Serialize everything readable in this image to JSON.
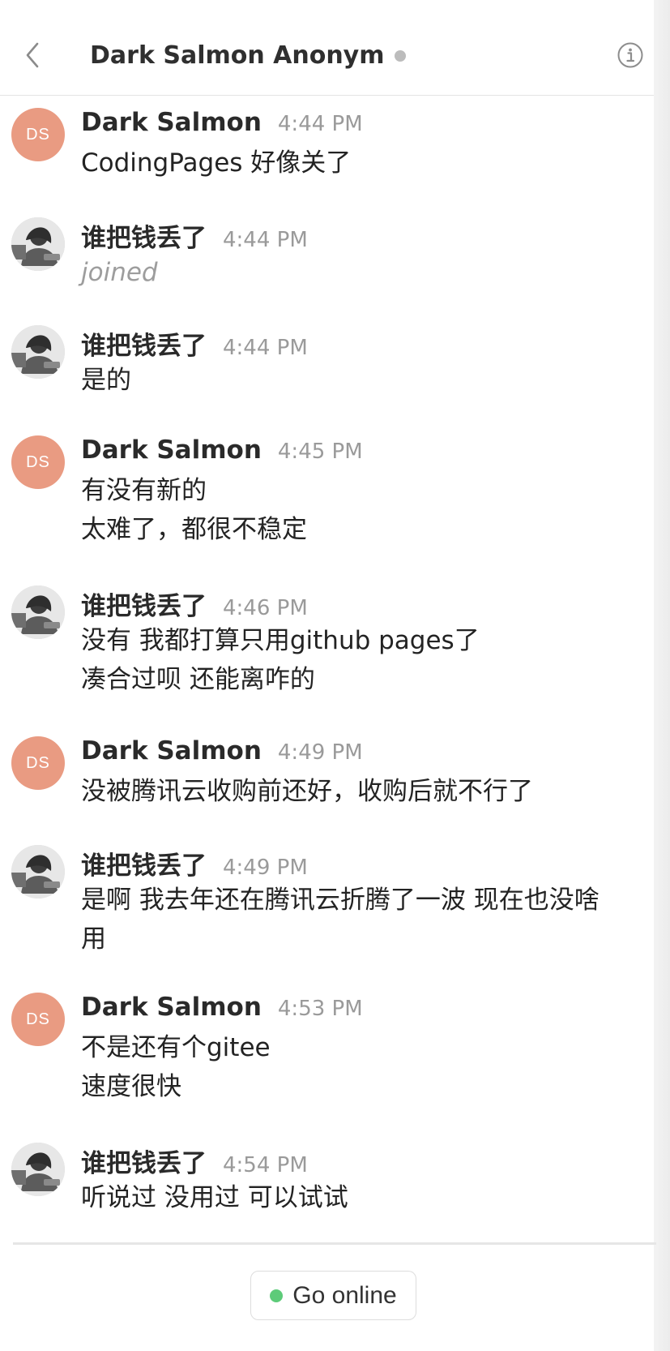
{
  "header": {
    "title": "Dark Salmon Anonym",
    "back_icon": "chevron-left-icon",
    "status_icon": "presence-dot-icon",
    "info_icon": "info-icon"
  },
  "avatars": {
    "ds": "DS"
  },
  "messages": [
    {
      "author": "Dark Salmon",
      "time": "4:44 PM",
      "lines": [
        "CodingPages 好像关了"
      ]
    },
    {
      "author": "谁把钱丢了",
      "time": "4:44 PM",
      "system": "joined"
    },
    {
      "author": "谁把钱丢了",
      "time": "4:44 PM",
      "lines": [
        "是的"
      ]
    },
    {
      "author": "Dark Salmon",
      "time": "4:45 PM",
      "lines": [
        "有没有新的",
        "太难了，都很不稳定"
      ]
    },
    {
      "author": "谁把钱丢了",
      "time": "4:46 PM",
      "lines": [
        "没有 我都打算只用github pages了",
        "凑合过呗 还能离咋的"
      ]
    },
    {
      "author": "Dark Salmon",
      "time": "4:49 PM",
      "lines": [
        "没被腾讯云收购前还好，收购后就不行了"
      ]
    },
    {
      "author": "谁把钱丢了",
      "time": "4:49 PM",
      "lines": [
        "是啊 我去年还在腾讯云折腾了一波 现在也没啥",
        "用"
      ]
    },
    {
      "author": "Dark Salmon",
      "time": "4:53 PM",
      "lines": [
        "不是还有个gitee",
        "速度很快"
      ]
    },
    {
      "author": "谁把钱丢了",
      "time": "4:54 PM",
      "lines": [
        "听说过 没用过 可以试试"
      ]
    }
  ],
  "footer": {
    "button_label": "Go online",
    "status_icon": "online-dot-icon"
  },
  "colors": {
    "ds_avatar": "#e99b82",
    "online": "#5dcb79",
    "muted_text": "#9a9a9a"
  }
}
